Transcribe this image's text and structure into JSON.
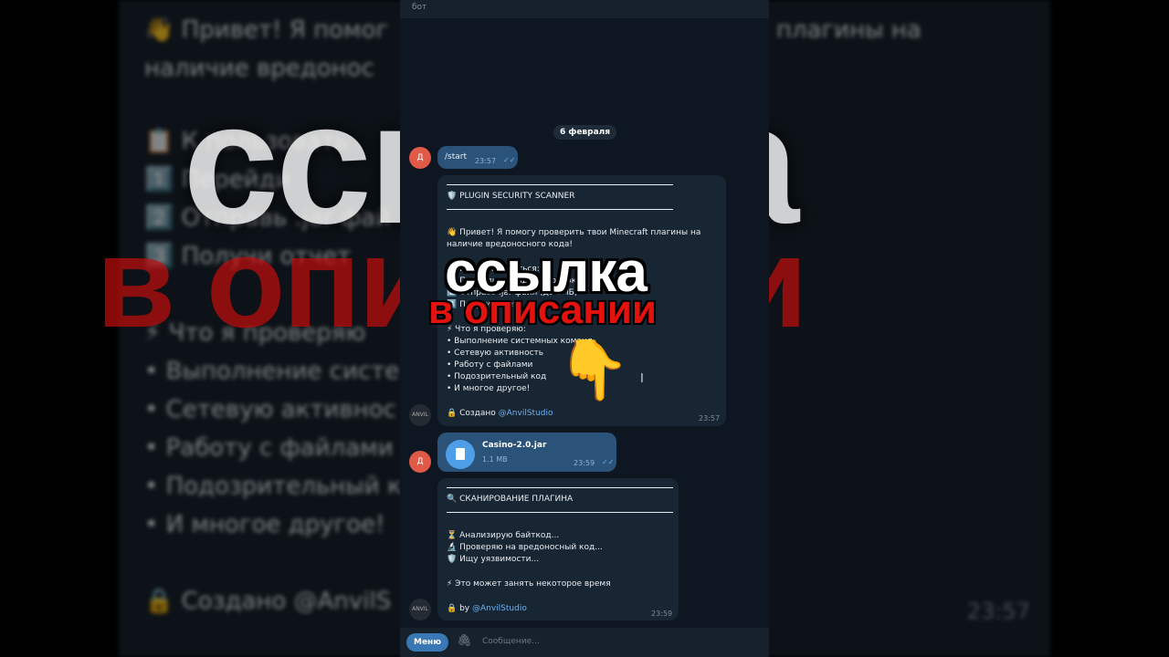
{
  "background": {
    "lines": [
      "👋 Привет! Я помог",
      "наличие вредонос",
      "📋 К пользовать",
      "1️⃣ Перейди",
      "2️⃣ Отправь .jar фай",
      "3️⃣ Получи отчет",
      "⚡ Что я проверяю",
      "• Выполнение систе",
      "• Сетевую активнос",
      "• Работу с файлами",
      "• Подозрительный к",
      "• И многое другое!",
      "🔒 Создано @AnvilS"
    ],
    "right_text": "плагины на",
    "time": "23:57",
    "big_white": "ссылка",
    "big_red": "в описании"
  },
  "header": {
    "subtitle": "бот"
  },
  "chat": {
    "date": "6 февраля",
    "avatar_user": "Д",
    "avatar_bot": "ANVIL",
    "msg1": {
      "text": "/start",
      "time": "23:57"
    },
    "msg2": {
      "title": "🛡️ PLUGIN SECURITY SCANNER",
      "greet1": "👋 Привет! Я помогу проверить твои Minecraft плагины на",
      "greet2": "наличие вредоносного кода!",
      "how": "📋 Как пользоваться:",
      "step1": "1️⃣ Перейди в раздел проверки",
      "step2": "2️⃣ Отправь .jar файл (до 2МБ)",
      "step3": "3️⃣ Получи отчет",
      "what": "⚡ Что я проверяю:",
      "b1": "• Выполнение системных команд",
      "b2": "• Сетевую активность",
      "b3": "• Работу с файлами",
      "b4": "• Подозрительный код",
      "b5": "• И многое другое!",
      "footer_prefix": "🔒 Создано ",
      "footer_link": "@AnvilStudio",
      "time": "23:57"
    },
    "msg3": {
      "filename": "Casino-2.0.jar",
      "size": "1.1 MB",
      "time": "23:59"
    },
    "msg4": {
      "title": "🔍 СКАНИРОВАНИЕ ПЛАГИНА",
      "l1": "⏳ Анализирую байткод...",
      "l2": "🔬 Проверяю на вредоносный код...",
      "l3": "🛡️ Ищу уязвимости...",
      "l4": "⚡ Это может занять некоторое время",
      "footer_prefix": "🔒 by ",
      "footer_link": "@AnvilStudio",
      "time": "23:59"
    }
  },
  "input": {
    "menu": "Меню",
    "placeholder": "Сообщение..."
  },
  "overlay": {
    "line1": "ссылка",
    "line2": "в описании",
    "hand": "👇"
  }
}
